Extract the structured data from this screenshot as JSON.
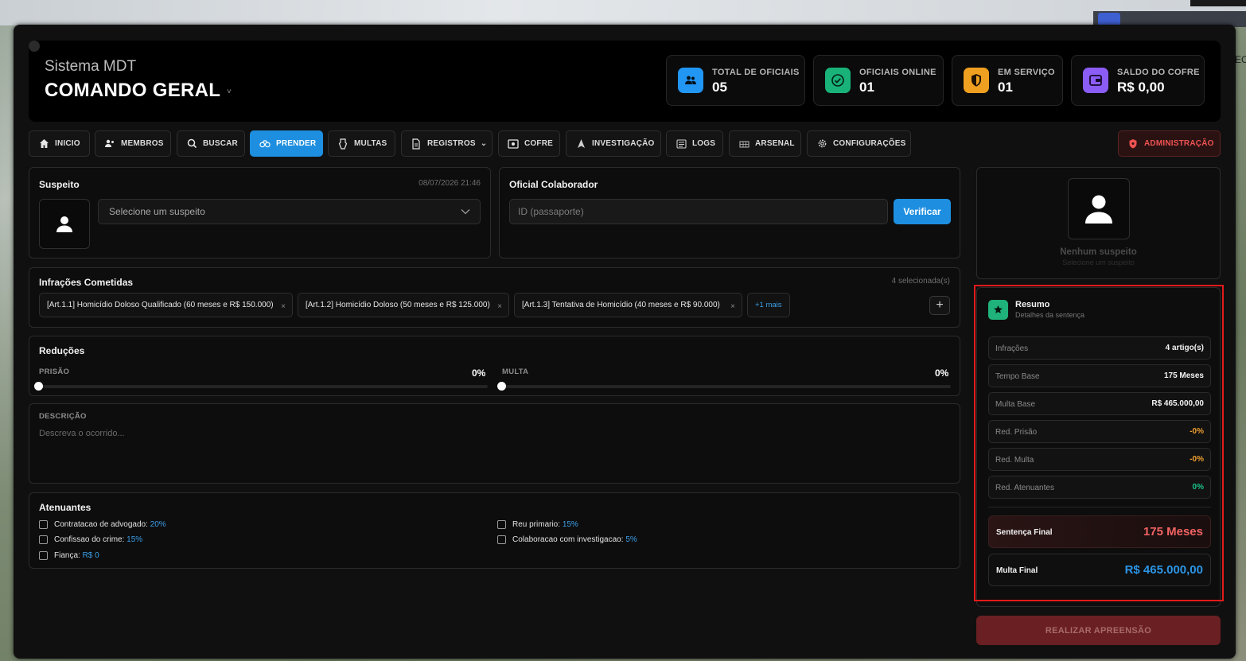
{
  "header": {
    "subtitle": "Sistema MDT",
    "title": "COMANDO GERAL",
    "caret": "˅"
  },
  "stats": [
    {
      "label": "TOTAL DE OFICIAIS",
      "value": "05",
      "icon": "users-icon",
      "color": "#2196f3"
    },
    {
      "label": "OFICIAIS ONLINE",
      "value": "01",
      "icon": "check-circle-icon",
      "color": "#19b37a"
    },
    {
      "label": "EM SERVIÇO",
      "value": "01",
      "icon": "shield-icon",
      "color": "#f0a020"
    },
    {
      "label": "SALDO DO COFRE",
      "value": "R$ 0,00",
      "icon": "wallet-icon",
      "color": "#8b5cf6"
    }
  ],
  "tabs": [
    {
      "label": "INICIO",
      "icon": "home-icon"
    },
    {
      "label": "MEMBROS",
      "icon": "users-icon"
    },
    {
      "label": "BUSCAR",
      "icon": "search-icon"
    },
    {
      "label": "PRENDER",
      "icon": "handcuffs-icon",
      "active": true
    },
    {
      "label": "MULTAS",
      "icon": "receipt-icon"
    },
    {
      "label": "REGISTROS",
      "icon": "document-icon",
      "caret": "⌄"
    },
    {
      "label": "COFRE",
      "icon": "safe-icon"
    },
    {
      "label": "INVESTIGAÇÃO",
      "icon": "navigation-icon"
    },
    {
      "label": "LOGS",
      "icon": "logs-icon"
    },
    {
      "label": "ARSENAL",
      "icon": "grid-icon"
    },
    {
      "label": "CONFIGURAÇÕES",
      "icon": "gear-icon"
    }
  ],
  "admin_tab": {
    "label": "ADMINISTRAÇÃO",
    "icon": "shield-icon"
  },
  "suspect": {
    "title": "Suspeito",
    "datetime": "08/07/2026 21:46",
    "select_placeholder": "Selecione um suspeito"
  },
  "officer": {
    "title": "Oficial Colaborador",
    "input_placeholder": "ID (passaporte)",
    "verify_label": "Verificar"
  },
  "infractions": {
    "title": "Infrações Cometidas",
    "count_label": "4 selecionada(s)",
    "chips": [
      "[Art.1.1] Homicídio Doloso Qualificado (60 meses e R$ 150.000)",
      "[Art.1.2] Homicídio Doloso (50 meses e R$ 125.000)",
      "[Art.1.3] Tentativa de Homicídio (40 meses e R$ 90.000)"
    ],
    "more_label": "+1 mais",
    "remove_symbol": "×",
    "add_symbol": "+"
  },
  "reductions": {
    "title": "Reduções",
    "prison_label": "PRISÃO",
    "prison_value": "0%",
    "prison_level": 0,
    "fine_label": "MULTA",
    "fine_value": "0%",
    "fine_level": 0
  },
  "description": {
    "label": "DESCRIÇÃO",
    "placeholder": "Descreva o ocorrido..."
  },
  "mitigating": {
    "title": "Atenuantes",
    "items": [
      {
        "label": "Contratacao de advogado:",
        "value": "20%"
      },
      {
        "label": "Confissao do crime:",
        "value": "15%"
      },
      {
        "label": "Fiança:",
        "value": "R$ 0"
      },
      {
        "label": "Reu primario:",
        "value": "15%"
      },
      {
        "label": "Colaboracao com investigacao:",
        "value": "5%"
      }
    ]
  },
  "suspect_card": {
    "name": "Nenhum suspeito",
    "hint": "Selecione um suspeito"
  },
  "summary": {
    "title": "Resumo",
    "subtitle": "Detalhes da sentença",
    "rows": [
      {
        "key": "Infrações",
        "value": "4 artigo(s)",
        "tone": "white"
      },
      {
        "key": "Tempo Base",
        "value": "175 Meses",
        "tone": "white"
      },
      {
        "key": "Multa Base",
        "value": "R$ 465.000,00",
        "tone": "white"
      },
      {
        "key": "Red. Prisão",
        "value": "-0%",
        "tone": "orange"
      },
      {
        "key": "Red. Multa",
        "value": "-0%",
        "tone": "orange"
      },
      {
        "key": "Red. Atenuantes",
        "value": "0%",
        "tone": "green"
      }
    ],
    "final_sentence_label": "Sentença Final",
    "final_sentence_value": "175 Meses",
    "final_fine_label": "Multa Final",
    "final_fine_value": "R$ 465.000,00"
  },
  "submit_label": "REALIZAR APREENSÃO",
  "background": {
    "right_edge_text": "EC"
  }
}
